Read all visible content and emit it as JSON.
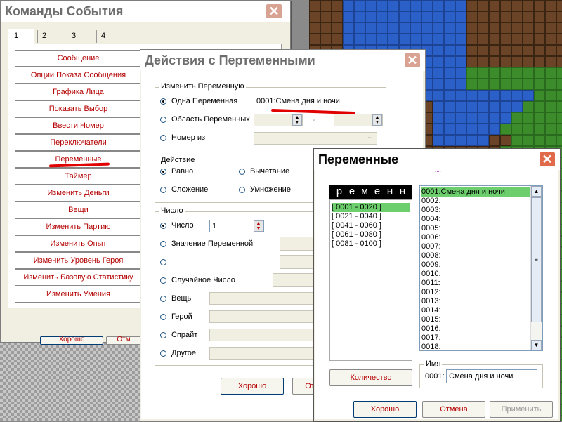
{
  "colors": {
    "accent_text": "#b40000",
    "selected_bg": "#6cce6c",
    "close_button": "#e06a4a",
    "annotation": "#e00000"
  },
  "events_window": {
    "title": "Команды События",
    "tabs": [
      "1",
      "2",
      "3",
      "4"
    ],
    "commands": [
      "Сообщение",
      "Опции Показа Сообщения",
      "Графика Лица",
      "Показать Выбор",
      "Ввести Номер",
      "Переключатели",
      "Переменные",
      "Таймер",
      "Изменить Деньги",
      "Вещи",
      "Изменить Партию",
      "Изменить Опыт",
      "Изменить Уровень Героя",
      "Изменить Базовую Статистику",
      "Изменить Умения"
    ],
    "ok_label": "Хорошо",
    "other_label": "Отм"
  },
  "var_actions_window": {
    "title": "Действия с Пертеменными",
    "change_group": {
      "label": "Изменить Переменную",
      "opt_single": "Одна Переменная",
      "single_value": "0001:Смена дня и ночи",
      "opt_range": "Область Переменных",
      "opt_number_from": "Номер из",
      "dots": "...",
      "dash": "-"
    },
    "action_group": {
      "label": "Действие",
      "equal": "Равно",
      "subtract": "Вычетание",
      "add": "Сложение",
      "multiply": "Умножение"
    },
    "number_group": {
      "label": "Число",
      "opt_number": "Число",
      "number_value": "1",
      "opt_var_value": "Значение Переменной",
      "opt_random": "Случайное Число",
      "opt_item": "Вещь",
      "opt_hero": "Герой",
      "opt_sprite": "Спрайт",
      "opt_other": "Другое"
    },
    "ok_label": "Хорошо",
    "cancel_partial": "От"
  },
  "variables_window": {
    "title": "Переменные",
    "marker": "....",
    "header_text": "р е м е н н",
    "groups": [
      "[ 0001 - 0020 ]",
      "[ 0021 - 0040 ]",
      "[ 0041 - 0060 ]",
      "[ 0061 - 0080 ]",
      "[ 0081 - 0100 ]"
    ],
    "variables": [
      "0001:Смена дня и ночи",
      "0002:",
      "0003:",
      "0004:",
      "0005:",
      "0006:",
      "0007:",
      "0008:",
      "0009:",
      "0010:",
      "0011:",
      "0012:",
      "0013:",
      "0014:",
      "0015:",
      "0016:",
      "0017:",
      "0018:"
    ],
    "quantity_label": "Количество",
    "name_group_label": "Имя",
    "name_id": "0001:",
    "name_value": "Смена дня и ночи",
    "ok_label": "Хорошо",
    "cancel_label": "Отмена",
    "apply_label": "Применить"
  }
}
